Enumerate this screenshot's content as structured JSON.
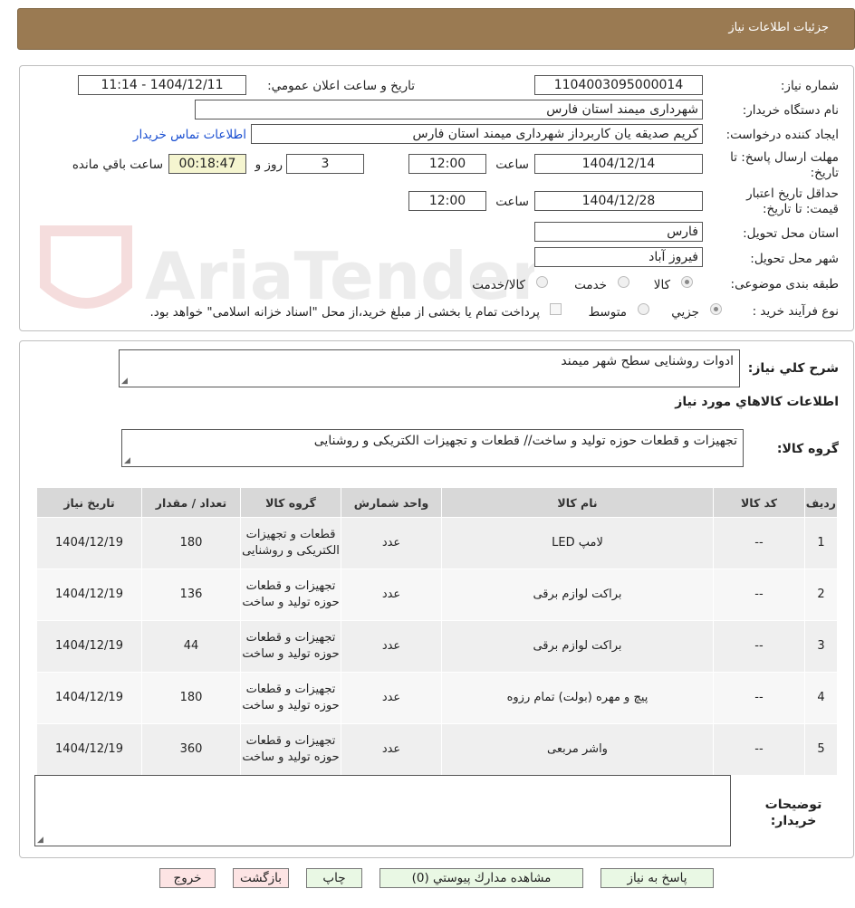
{
  "header": {
    "title": "جزئيات اطلاعات نياز"
  },
  "form": {
    "need_number_label": "شماره نياز:",
    "need_number": "1104003095000014",
    "announce_label": "تاريخ و ساعت اعلان عمومي:",
    "announce_value": "1404/12/11 - 11:14",
    "buyer_org_label": "نام دستگاه خريدار:",
    "buyer_org": "شهرداری میمند استان فارس",
    "requester_label": "ايجاد کننده درخواست:",
    "requester": "کریم  صدیقه یان  کاربرداز شهرداری میمند استان فارس",
    "contact_link": "اطلاعات تماس خريدار",
    "deadline_label": "مهلت ارسال پاسخ: تا تاريخ:",
    "deadline_date": "1404/12/14",
    "time_label": "ساعت",
    "deadline_time": "12:00",
    "days_value": "3",
    "days_label": "روز و",
    "remaining_time": "00:18:47",
    "remaining_label": "ساعت باقي مانده",
    "validity_label": "حداقل تاريخ اعتبار قيمت: تا تاريخ:",
    "validity_date": "1404/12/28",
    "validity_time": "12:00",
    "province_label": "استان محل تحويل:",
    "province": "فارس",
    "city_label": "شهر محل تحويل:",
    "city": "فیروز آباد",
    "category_label": "طبقه بندی موضوعی:",
    "category_options": [
      "کالا",
      "خدمت",
      "کالا/خدمت"
    ],
    "process_label": "نوع فرآيند خريد :",
    "process_options": [
      "جزيي",
      "متوسط"
    ],
    "payment_note": "پرداخت تمام یا بخشی از مبلغ خرید،از محل \"اسناد خزانه اسلامی\" خواهد بود."
  },
  "summary": {
    "desc_label": "شرح کلي نياز:",
    "desc_value": "ادوات روشنایی سطح شهر میمند",
    "items_title": "اطلاعات کالاهاي مورد نياز",
    "group_label": "گروه کالا:",
    "group_value": "تجهیزات و قطعات حوزه تولید و ساخت// قطعات و تجهیزات الکتریکی و روشنایی"
  },
  "table": {
    "headers": [
      "رديف",
      "کد کالا",
      "نام کالا",
      "واحد شمارش",
      "گروه کالا",
      "تعداد / مقدار",
      "تاريخ نياز"
    ],
    "rows": [
      {
        "row": "1",
        "code": "--",
        "name": "لامپ LED",
        "unit": "عدد",
        "group": "قطعات و تجهیزات الکتریکی و روشنایی",
        "qty": "180",
        "date": "1404/12/19"
      },
      {
        "row": "2",
        "code": "--",
        "name": "براکت لوازم برقی",
        "unit": "عدد",
        "group": "تجهیزات و قطعات حوزه تولید و ساخت",
        "qty": "136",
        "date": "1404/12/19"
      },
      {
        "row": "3",
        "code": "--",
        "name": "براکت لوازم برقی",
        "unit": "عدد",
        "group": "تجهیزات و قطعات حوزه تولید و ساخت",
        "qty": "44",
        "date": "1404/12/19"
      },
      {
        "row": "4",
        "code": "--",
        "name": "پیچ و مهره (بولت) تمام رزوه",
        "unit": "عدد",
        "group": "تجهیزات و قطعات حوزه تولید و ساخت",
        "qty": "180",
        "date": "1404/12/19"
      },
      {
        "row": "5",
        "code": "--",
        "name": "واشر مربعی",
        "unit": "عدد",
        "group": "تجهیزات و قطعات حوزه تولید و ساخت",
        "qty": "360",
        "date": "1404/12/19"
      }
    ]
  },
  "notes": {
    "label": "توضيحات خريدار:",
    "value": ""
  },
  "buttons": {
    "reply": "پاسخ به نياز",
    "attachments": "مشاهده مدارك پيوستي (0)",
    "print": "چاپ",
    "back": "بازگشت",
    "exit": "خروج"
  },
  "watermark": {
    "text": "AriaTender.neT"
  },
  "colors": {
    "header_bg": "#9a7a52",
    "link": "#1a4fd1",
    "remaining_bg": "#f5f5d0",
    "button_green": "#e9f8e4",
    "button_red": "#fde4e4"
  }
}
